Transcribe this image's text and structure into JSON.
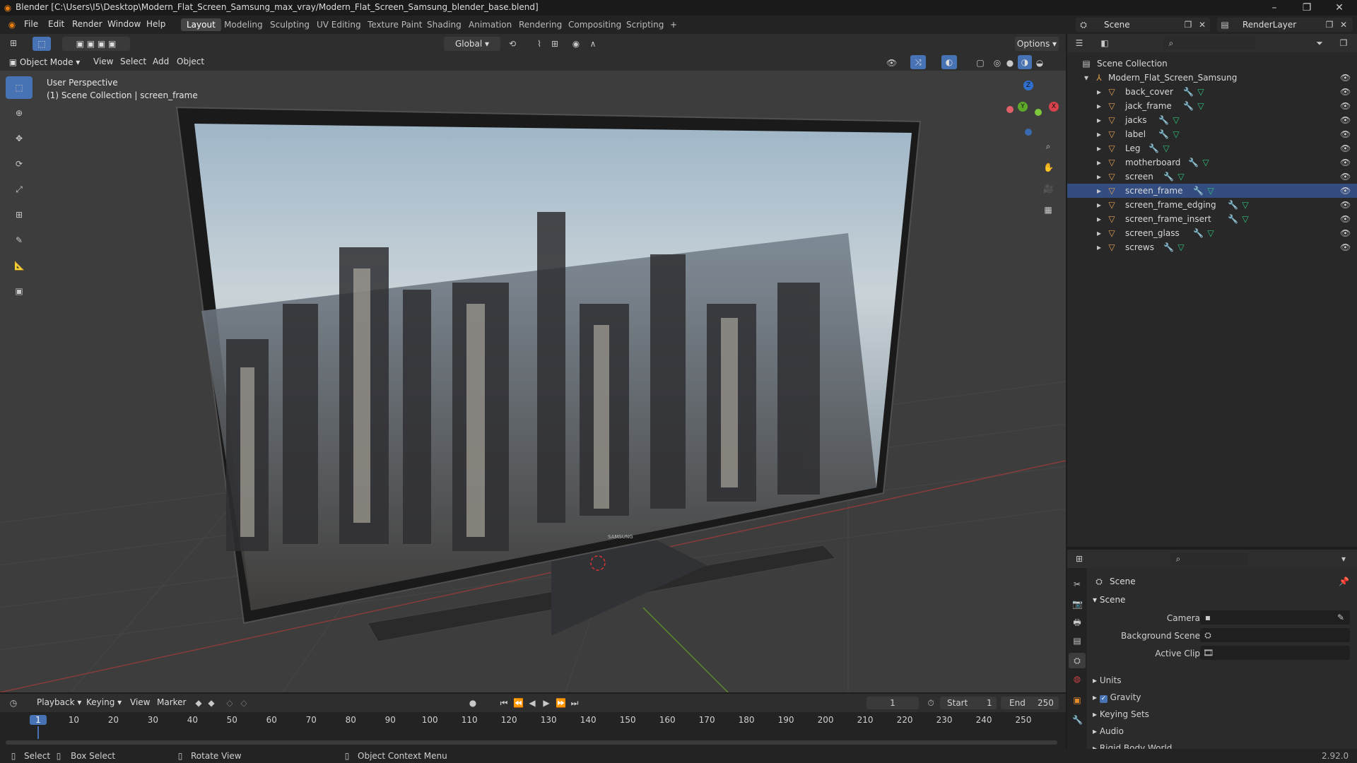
{
  "window": {
    "title": "Blender [C:\\Users\\I5\\Desktop\\Modern_Flat_Screen_Samsung_max_vray/Modern_Flat_Screen_Samsung_blender_base.blend]",
    "minimize": "–",
    "maximize": "❐",
    "close": "✕"
  },
  "menus": [
    "File",
    "Edit",
    "Render",
    "Window",
    "Help"
  ],
  "workspaces": [
    {
      "label": "Layout",
      "active": true
    },
    {
      "label": "Modeling",
      "active": false
    },
    {
      "label": "Sculpting",
      "active": false
    },
    {
      "label": "UV Editing",
      "active": false
    },
    {
      "label": "Texture Paint",
      "active": false
    },
    {
      "label": "Shading",
      "active": false
    },
    {
      "label": "Animation",
      "active": false
    },
    {
      "label": "Rendering",
      "active": false
    },
    {
      "label": "Compositing",
      "active": false
    },
    {
      "label": "Scripting",
      "active": false
    }
  ],
  "top_right": {
    "scene": "Scene",
    "render_layer": "RenderLayer"
  },
  "viewport_header": {
    "transform": "Global",
    "options": "Options",
    "mode": "Object Mode",
    "menu": [
      "View",
      "Select",
      "Add",
      "Object"
    ]
  },
  "viewport": {
    "perspective": "User Perspective",
    "collection_info": "(1) Scene Collection | screen_frame",
    "gizmo": {
      "x": "X",
      "y": "Y",
      "z": "Z"
    },
    "logo": "SAMSUNG"
  },
  "outliner": {
    "root": "Scene Collection",
    "collection": "Modern_Flat_Screen_Samsung",
    "objects": [
      "back_cover",
      "jack_frame",
      "jacks",
      "label",
      "Leg",
      "motherboard",
      "screen",
      "screen_frame",
      "screen_frame_edging",
      "screen_frame_insert",
      "screen_glass",
      "screws"
    ],
    "selected": "screen_frame"
  },
  "properties": {
    "header": "Scene",
    "section": "Scene",
    "fields": [
      {
        "label": "Camera"
      },
      {
        "label": "Background Scene"
      },
      {
        "label": "Active Clip"
      }
    ],
    "panels": [
      {
        "label": "Units",
        "checkbox": false
      },
      {
        "label": "Gravity",
        "checkbox": true
      },
      {
        "label": "Keying Sets",
        "checkbox": false
      },
      {
        "label": "Audio",
        "checkbox": false
      },
      {
        "label": "Rigid Body World",
        "checkbox": false
      }
    ]
  },
  "timeline": {
    "menus": [
      "Playback",
      "Keying",
      "View",
      "Marker"
    ],
    "current_frame": "1",
    "start_label": "Start",
    "start": "1",
    "end_label": "End",
    "end": "250",
    "ticks": [
      "1",
      "10",
      "20",
      "30",
      "40",
      "50",
      "60",
      "70",
      "80",
      "90",
      "100",
      "110",
      "120",
      "130",
      "140",
      "150",
      "160",
      "170",
      "180",
      "190",
      "200",
      "210",
      "220",
      "230",
      "240",
      "250"
    ]
  },
  "statusbar": {
    "items": [
      "Select",
      "Box Select",
      "Rotate View",
      "Object Context Menu"
    ],
    "version": "2.92.0"
  },
  "colors": {
    "accent": "#4772b3",
    "object_icon": "#e5a050",
    "modifier_icon": "#6a9bd8",
    "mesh_icon": "#2fc27a"
  }
}
